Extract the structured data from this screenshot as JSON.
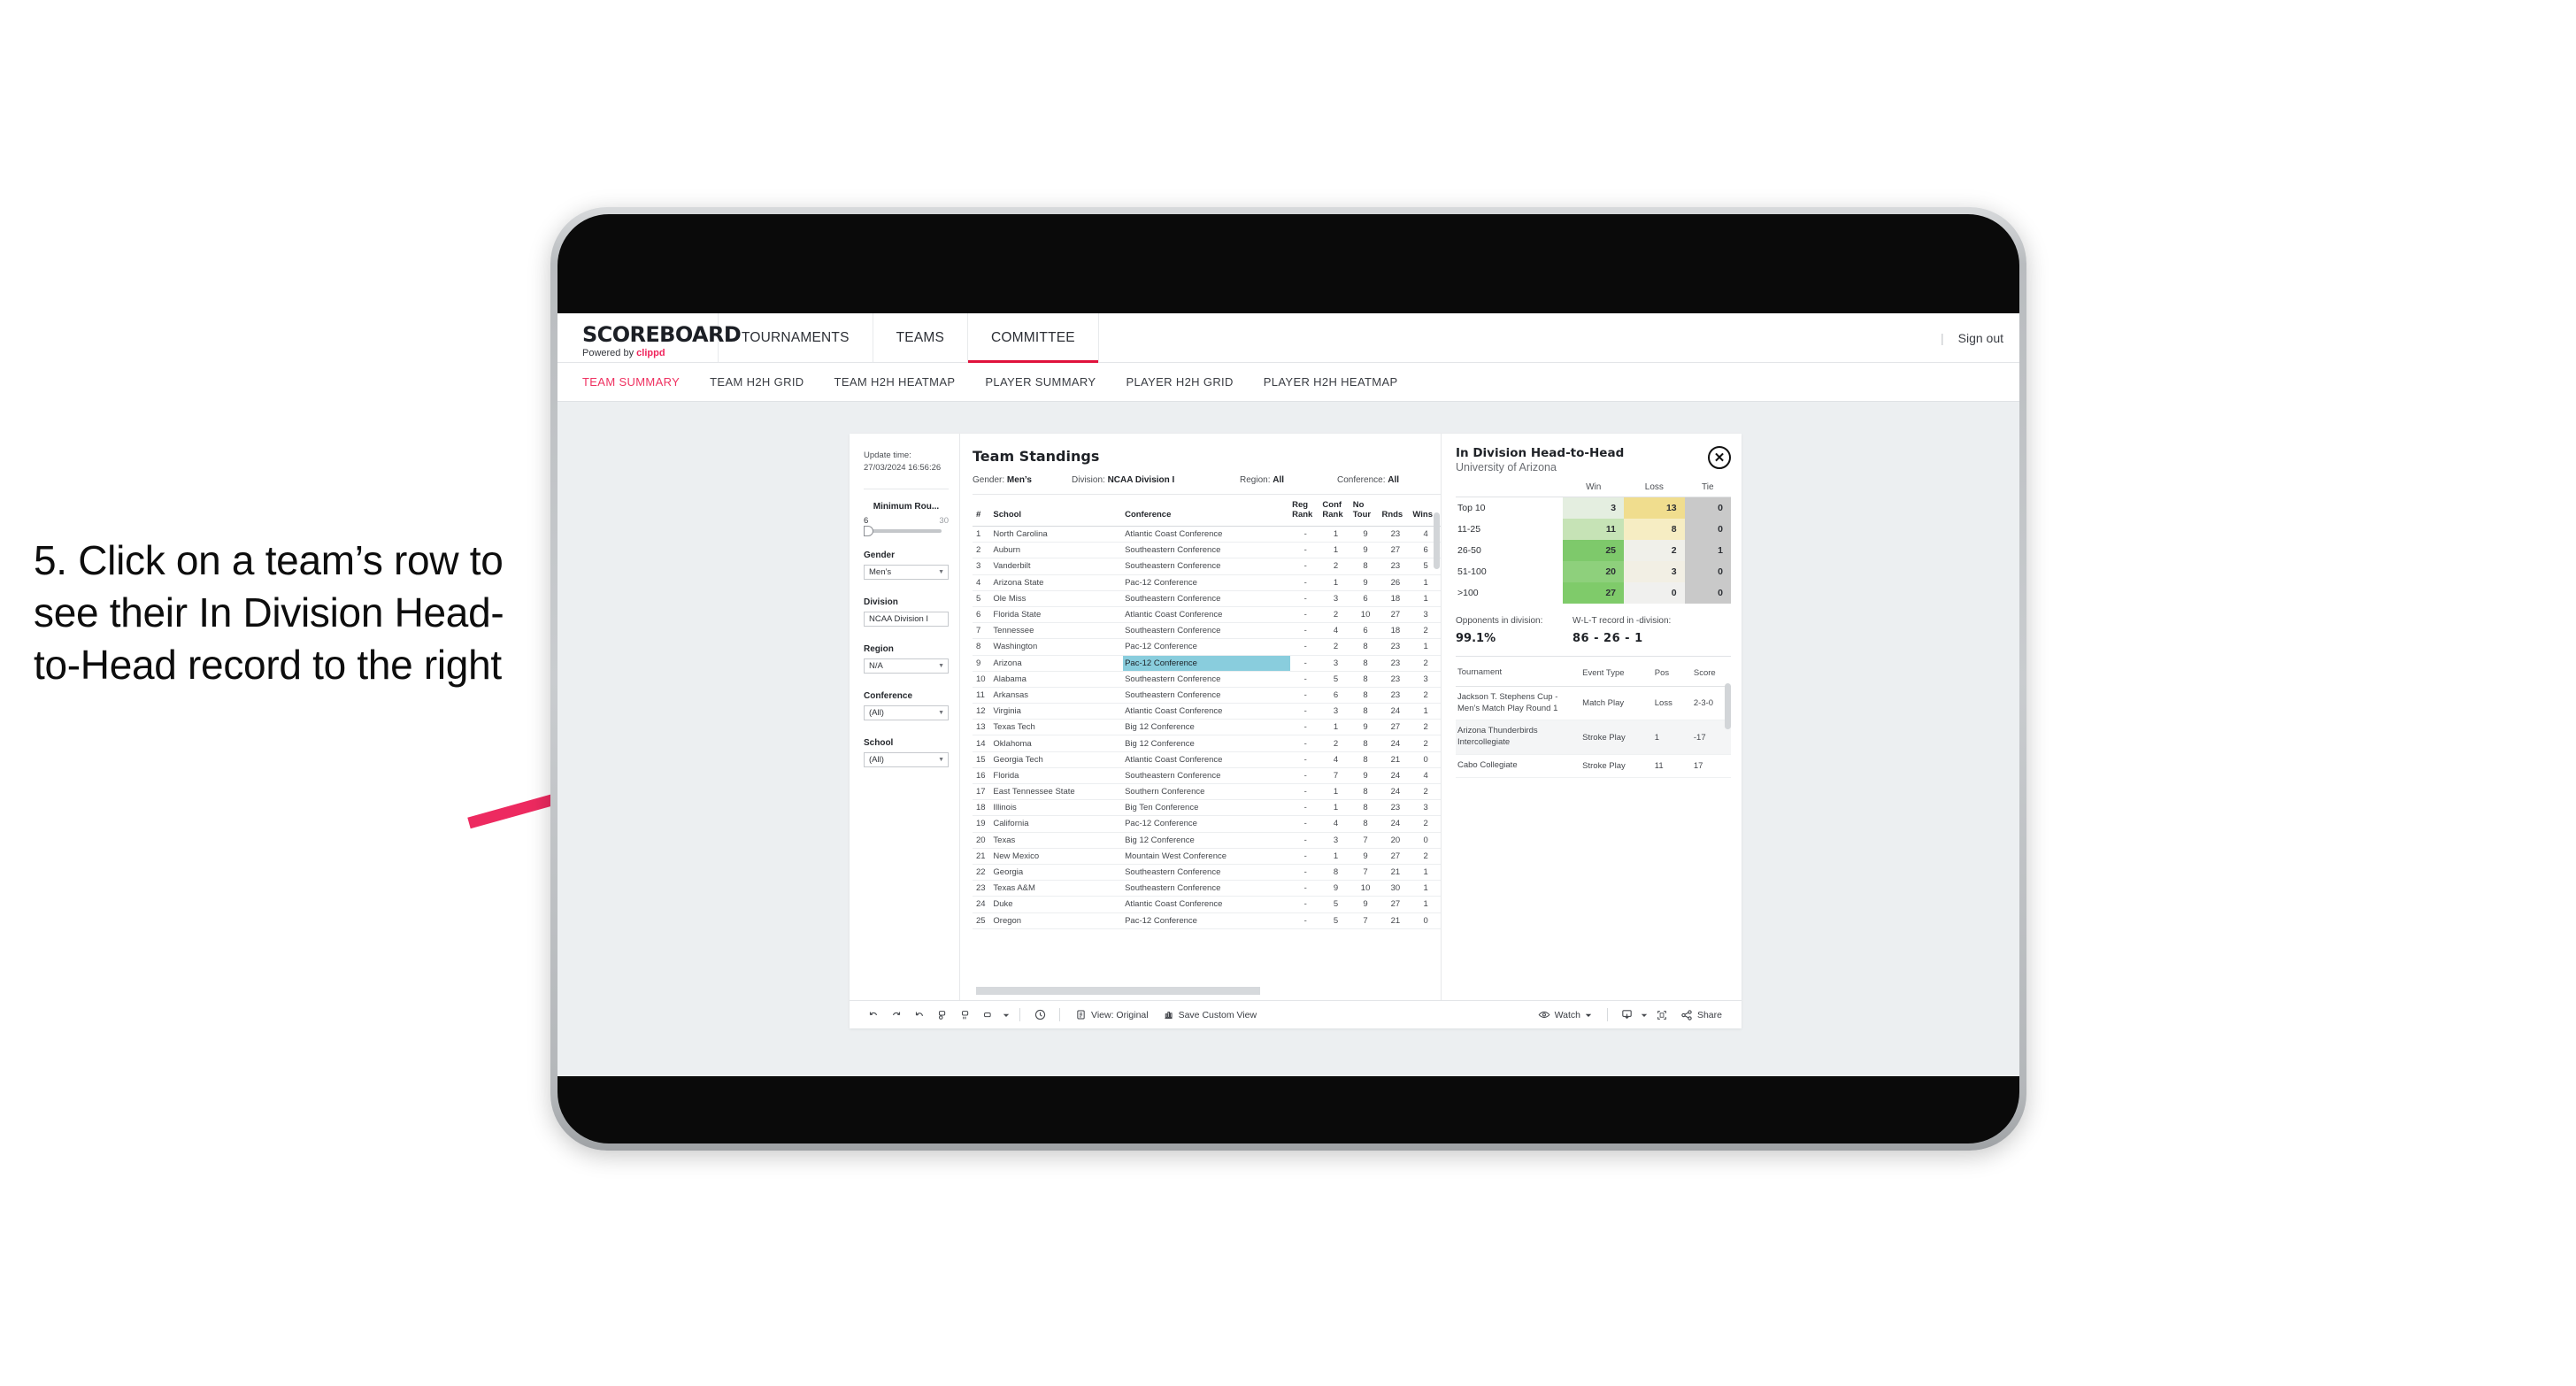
{
  "annotation": {
    "text": "5. Click on a team’s row to see their In Division Head-to-Head record to the right",
    "arrow_color": "#ED2A60"
  },
  "app": {
    "brand": {
      "title": "SCOREBOARD",
      "powered_prefix": "Powered by",
      "powered_name": "clippd"
    },
    "top_nav": [
      {
        "label": "TOURNAMENTS",
        "active": false
      },
      {
        "label": "TEAMS",
        "active": false
      },
      {
        "label": "COMMITTEE",
        "active": true
      }
    ],
    "sign_out": "Sign out",
    "divider": "|",
    "sub_nav": [
      {
        "label": "TEAM SUMMARY",
        "active": true
      },
      {
        "label": "TEAM H2H GRID",
        "active": false
      },
      {
        "label": "TEAM H2H HEATMAP",
        "active": false
      },
      {
        "label": "PLAYER SUMMARY",
        "active": false
      },
      {
        "label": "PLAYER H2H GRID",
        "active": false
      },
      {
        "label": "PLAYER H2H HEATMAP",
        "active": false
      }
    ]
  },
  "filters": {
    "update_label": "Update time:",
    "update_time": "27/03/2024 16:56:26",
    "slider": {
      "title": "Minimum Rou...",
      "min": "6",
      "max": "30"
    },
    "controls": [
      {
        "title": "Gender",
        "value": "Men’s"
      },
      {
        "title": "Division",
        "value": "NCAA Division I"
      },
      {
        "title": "Region",
        "value": "N/A"
      },
      {
        "title": "Conference",
        "value": "(All)"
      },
      {
        "title": "School",
        "value": "(All)"
      }
    ]
  },
  "standings": {
    "title": "Team Standings",
    "summary": [
      {
        "label": "Gender:",
        "value": "Men’s"
      },
      {
        "label": "Division:",
        "value": "NCAA Division I"
      },
      {
        "label": "Region:",
        "value": "All"
      },
      {
        "label": "Conference:",
        "value": "All"
      }
    ],
    "columns": [
      "#",
      "School",
      "Conference",
      "Reg Rank",
      "Conf Rank",
      "No Tour",
      "Rnds",
      "Wins"
    ],
    "selected_row_index": 8,
    "rows": [
      {
        "num": "1",
        "school": "North Carolina",
        "conference": "Atlantic Coast Conference",
        "reg_rank": "-",
        "conf_rank": "1",
        "no_tour": "9",
        "rnds": "23",
        "wins": "4"
      },
      {
        "num": "2",
        "school": "Auburn",
        "conference": "Southeastern Conference",
        "reg_rank": "-",
        "conf_rank": "1",
        "no_tour": "9",
        "rnds": "27",
        "wins": "6"
      },
      {
        "num": "3",
        "school": "Vanderbilt",
        "conference": "Southeastern Conference",
        "reg_rank": "-",
        "conf_rank": "2",
        "no_tour": "8",
        "rnds": "23",
        "wins": "5"
      },
      {
        "num": "4",
        "school": "Arizona State",
        "conference": "Pac-12 Conference",
        "reg_rank": "-",
        "conf_rank": "1",
        "no_tour": "9",
        "rnds": "26",
        "wins": "1"
      },
      {
        "num": "5",
        "school": "Ole Miss",
        "conference": "Southeastern Conference",
        "reg_rank": "-",
        "conf_rank": "3",
        "no_tour": "6",
        "rnds": "18",
        "wins": "1"
      },
      {
        "num": "6",
        "school": "Florida State",
        "conference": "Atlantic Coast Conference",
        "reg_rank": "-",
        "conf_rank": "2",
        "no_tour": "10",
        "rnds": "27",
        "wins": "3"
      },
      {
        "num": "7",
        "school": "Tennessee",
        "conference": "Southeastern Conference",
        "reg_rank": "-",
        "conf_rank": "4",
        "no_tour": "6",
        "rnds": "18",
        "wins": "2"
      },
      {
        "num": "8",
        "school": "Washington",
        "conference": "Pac-12 Conference",
        "reg_rank": "-",
        "conf_rank": "2",
        "no_tour": "8",
        "rnds": "23",
        "wins": "1"
      },
      {
        "num": "9",
        "school": "Arizona",
        "conference": "Pac-12 Conference",
        "reg_rank": "-",
        "conf_rank": "3",
        "no_tour": "8",
        "rnds": "23",
        "wins": "2"
      },
      {
        "num": "10",
        "school": "Alabama",
        "conference": "Southeastern Conference",
        "reg_rank": "-",
        "conf_rank": "5",
        "no_tour": "8",
        "rnds": "23",
        "wins": "3"
      },
      {
        "num": "11",
        "school": "Arkansas",
        "conference": "Southeastern Conference",
        "reg_rank": "-",
        "conf_rank": "6",
        "no_tour": "8",
        "rnds": "23",
        "wins": "2"
      },
      {
        "num": "12",
        "school": "Virginia",
        "conference": "Atlantic Coast Conference",
        "reg_rank": "-",
        "conf_rank": "3",
        "no_tour": "8",
        "rnds": "24",
        "wins": "1"
      },
      {
        "num": "13",
        "school": "Texas Tech",
        "conference": "Big 12 Conference",
        "reg_rank": "-",
        "conf_rank": "1",
        "no_tour": "9",
        "rnds": "27",
        "wins": "2"
      },
      {
        "num": "14",
        "school": "Oklahoma",
        "conference": "Big 12 Conference",
        "reg_rank": "-",
        "conf_rank": "2",
        "no_tour": "8",
        "rnds": "24",
        "wins": "2"
      },
      {
        "num": "15",
        "school": "Georgia Tech",
        "conference": "Atlantic Coast Conference",
        "reg_rank": "-",
        "conf_rank": "4",
        "no_tour": "8",
        "rnds": "21",
        "wins": "0"
      },
      {
        "num": "16",
        "school": "Florida",
        "conference": "Southeastern Conference",
        "reg_rank": "-",
        "conf_rank": "7",
        "no_tour": "9",
        "rnds": "24",
        "wins": "4"
      },
      {
        "num": "17",
        "school": "East Tennessee State",
        "conference": "Southern Conference",
        "reg_rank": "-",
        "conf_rank": "1",
        "no_tour": "8",
        "rnds": "24",
        "wins": "2"
      },
      {
        "num": "18",
        "school": "Illinois",
        "conference": "Big Ten Conference",
        "reg_rank": "-",
        "conf_rank": "1",
        "no_tour": "8",
        "rnds": "23",
        "wins": "3"
      },
      {
        "num": "19",
        "school": "California",
        "conference": "Pac-12 Conference",
        "reg_rank": "-",
        "conf_rank": "4",
        "no_tour": "8",
        "rnds": "24",
        "wins": "2"
      },
      {
        "num": "20",
        "school": "Texas",
        "conference": "Big 12 Conference",
        "reg_rank": "-",
        "conf_rank": "3",
        "no_tour": "7",
        "rnds": "20",
        "wins": "0"
      },
      {
        "num": "21",
        "school": "New Mexico",
        "conference": "Mountain West Conference",
        "reg_rank": "-",
        "conf_rank": "1",
        "no_tour": "9",
        "rnds": "27",
        "wins": "2"
      },
      {
        "num": "22",
        "school": "Georgia",
        "conference": "Southeastern Conference",
        "reg_rank": "-",
        "conf_rank": "8",
        "no_tour": "7",
        "rnds": "21",
        "wins": "1"
      },
      {
        "num": "23",
        "school": "Texas A&M",
        "conference": "Southeastern Conference",
        "reg_rank": "-",
        "conf_rank": "9",
        "no_tour": "10",
        "rnds": "30",
        "wins": "1"
      },
      {
        "num": "24",
        "school": "Duke",
        "conference": "Atlantic Coast Conference",
        "reg_rank": "-",
        "conf_rank": "5",
        "no_tour": "9",
        "rnds": "27",
        "wins": "1"
      },
      {
        "num": "25",
        "school": "Oregon",
        "conference": "Pac-12 Conference",
        "reg_rank": "-",
        "conf_rank": "5",
        "no_tour": "7",
        "rnds": "21",
        "wins": "0"
      }
    ]
  },
  "h2h_panel": {
    "title": "In Division Head-to-Head",
    "subtitle": "University of Arizona",
    "close_icon": "✕",
    "chart_data": {
      "type": "heatmap",
      "title": "In Division Head-to-Head",
      "subtitle": "University of Arizona",
      "columns": [
        "Win",
        "Loss",
        "Tie"
      ],
      "categories": [
        "Top 10",
        "11-25",
        "26-50",
        "51-100",
        ">100"
      ],
      "series": [
        {
          "name": "Win",
          "values": [
            3,
            11,
            25,
            20,
            27
          ]
        },
        {
          "name": "Loss",
          "values": [
            13,
            8,
            2,
            3,
            0
          ]
        },
        {
          "name": "Tie",
          "values": [
            0,
            0,
            1,
            0,
            0
          ]
        }
      ],
      "cell_colors": {
        "win": [
          "#e4eee0",
          "#c6e3b6",
          "#7ec96b",
          "#8ed07c",
          "#7fcb6a"
        ],
        "loss": [
          "#f0dd8e",
          "#f6edc3",
          "#f0f0ea",
          "#f2efe4",
          "#f0f0ee"
        ],
        "tie": [
          "#c9c9c9",
          "#c9c9c9",
          "#c9c9c9",
          "#c9c9c9",
          "#c9c9c9"
        ]
      },
      "legend_position": "top"
    },
    "stats": [
      {
        "label": "Opponents in division:",
        "value": "99.1%"
      },
      {
        "label": "W-L-T record in -division:",
        "value": "86 - 26 - 1"
      }
    ],
    "tournament_columns": [
      "Tournament",
      "Event Type",
      "Pos",
      "Score"
    ],
    "tournaments": [
      {
        "name": "Jackson T. Stephens Cup - Men’s Match Play Round 1",
        "event_type": "Match Play",
        "pos": "Loss",
        "score": "2-3-0"
      },
      {
        "name": "Arizona Thunderbirds Intercollegiate",
        "event_type": "Stroke Play",
        "pos": "1",
        "score": "-17"
      },
      {
        "name": "Cabo Collegiate",
        "event_type": "Stroke Play",
        "pos": "11",
        "score": "17"
      }
    ]
  },
  "toolbar": {
    "view_label": "View: Original",
    "save_label": "Save Custom View",
    "watch_label": "Watch",
    "share_label": "Share"
  }
}
